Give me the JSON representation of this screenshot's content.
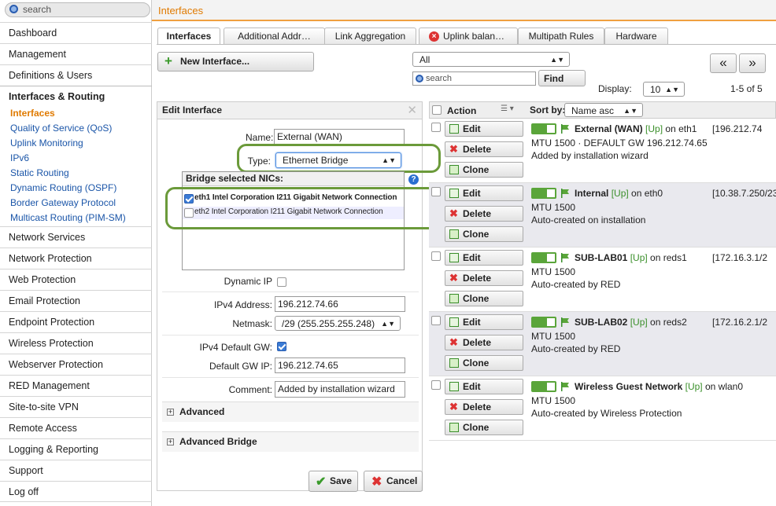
{
  "search": {
    "placeholder": "search"
  },
  "header": {
    "breadcrumb": "Interfaces"
  },
  "sidebar": {
    "items": [
      {
        "label": "Dashboard"
      },
      {
        "label": "Management"
      },
      {
        "label": "Definitions & Users"
      },
      {
        "label": "Interfaces & Routing"
      },
      {
        "label": "Network Services"
      },
      {
        "label": "Network Protection"
      },
      {
        "label": "Web Protection"
      },
      {
        "label": "Email Protection"
      },
      {
        "label": "Endpoint Protection"
      },
      {
        "label": "Wireless Protection"
      },
      {
        "label": "Webserver Protection"
      },
      {
        "label": "RED Management"
      },
      {
        "label": "Site-to-site VPN"
      },
      {
        "label": "Remote Access"
      },
      {
        "label": "Logging & Reporting"
      },
      {
        "label": "Support"
      },
      {
        "label": "Log off"
      }
    ],
    "subitems": [
      {
        "label": "Interfaces"
      },
      {
        "label": "Quality of Service (QoS)"
      },
      {
        "label": "Uplink Monitoring"
      },
      {
        "label": "IPv6"
      },
      {
        "label": "Static Routing"
      },
      {
        "label": "Dynamic Routing (OSPF)"
      },
      {
        "label": "Border Gateway Protocol"
      },
      {
        "label": "Multicast Routing (PIM-SM)"
      }
    ]
  },
  "tabs": [
    {
      "label": "Interfaces"
    },
    {
      "label": "Additional Addr…"
    },
    {
      "label": "Link Aggregation"
    },
    {
      "label": "Uplink balan…"
    },
    {
      "label": "Multipath Rules"
    },
    {
      "label": "Hardware"
    }
  ],
  "toolbar": {
    "new_interface": "New Interface...",
    "filter_value": "All",
    "search_placeholder": "search",
    "find": "Find",
    "display_label": "Display:",
    "display_value": "10",
    "pagination": "1-5 of 5",
    "prev": "«",
    "next": "»"
  },
  "edit": {
    "title": "Edit Interface",
    "name_label": "Name:",
    "name_value": "External (WAN)",
    "type_label": "Type:",
    "type_value": "Ethernet Bridge",
    "nics_label": "Bridge selected NICs:",
    "nics": [
      {
        "label": "eth1 Intel Corporation I211 Gigabit Network Connection",
        "checked": true
      },
      {
        "label": "eth2 Intel Corporation I211 Gigabit Network Connection",
        "checked": false
      }
    ],
    "dynamic_ip_label": "Dynamic IP",
    "ipv4_label": "IPv4 Address:",
    "ipv4_value": "196.212.74.66",
    "netmask_label": "Netmask:",
    "netmask_value": "/29 (255.255.255.248)",
    "default_gw_label": "IPv4 Default GW:",
    "default_gw_ip_label": "Default GW IP:",
    "default_gw_ip_value": "196.212.74.65",
    "comment_label": "Comment:",
    "comment_value": "Added by installation wizard",
    "advanced": "Advanced",
    "advanced_bridge": "Advanced Bridge",
    "save": "Save",
    "cancel": "Cancel"
  },
  "list": {
    "action_header": "Action",
    "sort_label": "Sort by:",
    "sort_value": "Name asc",
    "edit_btn": "Edit",
    "delete_btn": "Delete",
    "clone_btn": "Clone",
    "rows": [
      {
        "name": "External (WAN)",
        "status": "[Up]",
        "on": "on eth1",
        "ip": "[196.212.74",
        "line1": "MTU 1500 · DEFAULT GW 196.212.74.65",
        "line2": "Added by installation wizard"
      },
      {
        "name": "Internal",
        "status": "[Up]",
        "on": "on eth0",
        "ip": "[10.38.7.250/23]",
        "line1": "MTU 1500",
        "line2": "Auto-created on installation"
      },
      {
        "name": "SUB-LAB01",
        "status": "[Up]",
        "on": "on reds1",
        "ip": "[172.16.3.1/2",
        "line1": "MTU 1500",
        "line2": "Auto-created by RED"
      },
      {
        "name": "SUB-LAB02",
        "status": "[Up]",
        "on": "on reds2",
        "ip": "[172.16.2.1/2",
        "line1": "MTU 1500",
        "line2": "Auto-created by RED"
      },
      {
        "name": "Wireless Guest Network",
        "status": "[Up]",
        "on": "on wlan0",
        "ip": "",
        "line1": "MTU 1500",
        "line2": "Auto-created by Wireless Protection"
      }
    ]
  }
}
